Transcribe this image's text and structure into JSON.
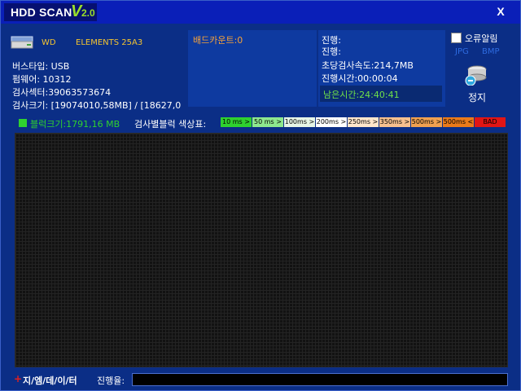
{
  "titlebar": {
    "app_name": "HDD SCAN",
    "version_v": "V",
    "version_num": "2.0",
    "close_label": "X"
  },
  "drive": {
    "vendor": "WD",
    "model": "ELEMENTS 25A3",
    "bus_type": "버스타입: USB",
    "firmware": "펌웨어: 10312",
    "sectors": "검사섹터:39063573674",
    "scan_size": "검사크기: [19074010,58MB] / [18627,0"
  },
  "bad_count": "배드카운트:0",
  "stats": {
    "progress1": "진행:",
    "progress2": "진행:",
    "speed": "초당검사속도:214,7MB",
    "elapsed": "진행시간:00:00:04",
    "remaining": "남은시간:24:40:41"
  },
  "options": {
    "error_alarm": "오류알림",
    "error_alarm_checked": false,
    "jpg": "JPG",
    "bmp": "BMP",
    "stop": "정지"
  },
  "legend": {
    "block_size": "블럭크기:1791,16 MB",
    "label": "검사별블럭 색상표:",
    "items": [
      {
        "label": "10 ms >",
        "color": "#2fd12f"
      },
      {
        "label": "50 ms >",
        "color": "#8ee88e"
      },
      {
        "label": "100ms >",
        "color": "#e6f5e6"
      },
      {
        "label": "200ms >",
        "color": "#ffffff"
      },
      {
        "label": "250ms >",
        "color": "#ffe6cc"
      },
      {
        "label": "350ms >",
        "color": "#f7c08f"
      },
      {
        "label": "500ms >",
        "color": "#f0a050"
      },
      {
        "label": "500ms <",
        "color": "#ea7a1a"
      },
      {
        "label": "BAD",
        "color": "#e01515"
      }
    ]
  },
  "footer": {
    "plus": "+",
    "brand": "지/엠/데/이/터",
    "progress_label": "진행율:",
    "progress_value": 0
  },
  "colors": {
    "background": "#0b2e86",
    "titlebar": "#0a1fb8",
    "accent_green": "#2fd12f",
    "accent_orange": "#f4a13a"
  }
}
